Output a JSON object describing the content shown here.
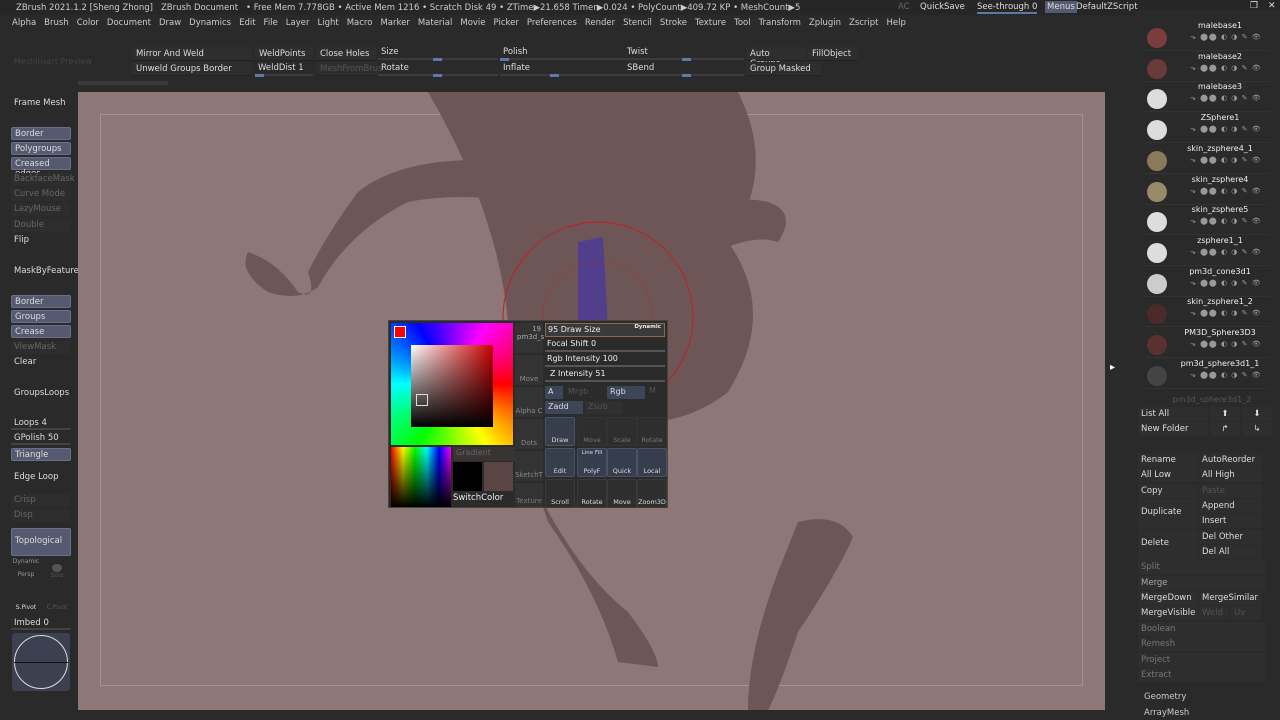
{
  "title": {
    "app": "ZBrush 2021.1.2 [Sheng Zhong]",
    "doc": "ZBrush Document",
    "stats": "• Free Mem 7.778GB • Active Mem 1216 • Scratch Disk 49 • ZTime▶21.658 Timer▶0.024 • PolyCount▶409.72 KP • MeshCount▶5",
    "ac": "AC",
    "quicksave": "QuickSave",
    "seethrough": "See-through  0",
    "menus": "Menus",
    "script": "DefaultZScript"
  },
  "menus": [
    "Alpha",
    "Brush",
    "Color",
    "Document",
    "Draw",
    "Dynamics",
    "Edit",
    "File",
    "Layer",
    "Light",
    "Macro",
    "Marker",
    "Material",
    "Movie",
    "Picker",
    "Preferences",
    "Render",
    "Stencil",
    "Stroke",
    "Texture",
    "Tool",
    "Transform",
    "Zplugin",
    "Zscript",
    "Help"
  ],
  "shelf": {
    "meshinsert": "MeshInsert Preview",
    "mirror_weld": "Mirror And Weld",
    "unweld": "Unweld Groups Border",
    "weldpoints": "WeldPoints",
    "welddist": "WeldDist 1",
    "close_holes": "Close Holes",
    "meshfrombrush": "MeshFromBrus",
    "size": "Size",
    "rotate": "Rotate",
    "polish": "Polish",
    "inflate": "Inflate",
    "twist": "Twist",
    "sbend": "SBend",
    "auto_groups": "Auto Groups",
    "fillobject": "FillObject",
    "group_masked": "Group Masked"
  },
  "left": {
    "frame_mesh": "Frame Mesh",
    "border": "Border",
    "polygroups": "Polygroups",
    "creased": "Creased edges",
    "backface": "BackfaceMask",
    "curve": "Curve Mode",
    "lazy": "LazyMouse",
    "double": "Double",
    "flip": "Flip",
    "maskbyfeature": "MaskByFeature",
    "border2": "Border",
    "groups": "Groups",
    "crease": "Crease",
    "viewmask": "ViewMask",
    "clear": "Clear",
    "groupsloops": "GroupsLoops",
    "loops": "Loops 4",
    "gpolish": "GPolish 50",
    "triangle": "Triangle",
    "edgeloop": "Edge Loop",
    "crisp": "Crisp",
    "disp": "Disp",
    "topological": "Topological",
    "persp": "Persp",
    "solo": "Solo",
    "dynamic": "Dynamic",
    "spivot": "S.Pivot",
    "cpivot": "C.Pivot",
    "imbed": "Imbed 0"
  },
  "popup": {
    "count": "19",
    "tool": "pm3d_s",
    "move": "Move",
    "alpha": "Alpha C",
    "dots": "Dots",
    "sketch": "SketchT",
    "texture": "Texture",
    "gradient": "Gradient",
    "switchcolor": "SwitchColor",
    "draw_size": "95 Draw Size",
    "dynamic": "Dynamic",
    "focal": "Focal Shift 0",
    "rgb_int": "Rgb Intensity 100",
    "z_int": "Z Intensity 51",
    "a": "A",
    "mrgb": "Mrgb",
    "rgb": "Rgb",
    "m": "M",
    "zadd": "Zadd",
    "zsub": "Zsub",
    "draw": "Draw",
    "pmove": "Move",
    "scale": "Scale",
    "protate": "Rotate",
    "edit": "Edit",
    "linefill": "Line Fill",
    "polyf": "PolyF",
    "quick": "Quick",
    "local": "Local",
    "scroll": "Scroll",
    "vrotate": "Rotate",
    "vmove": "Move",
    "zoom3d": "Zoom3D"
  },
  "subtools": [
    {
      "name": "malebase1",
      "c": "#7a3c3c"
    },
    {
      "name": "malebase2",
      "c": "#6a3a3a"
    },
    {
      "name": "malebase3",
      "c": "#ddd"
    },
    {
      "name": "ZSphere1",
      "c": "#ddd"
    },
    {
      "name": "skin_zsphere4_1",
      "c": "#8a7a5a"
    },
    {
      "name": "skin_zsphere4",
      "c": "#9a8a6a"
    },
    {
      "name": "skin_zsphere5",
      "c": "#ddd"
    },
    {
      "name": "zsphere1_1",
      "c": "#ddd"
    },
    {
      "name": "pm3d_cone3d1",
      "c": "#ccc"
    },
    {
      "name": "skin_zsphere1_2",
      "c": "#4a2a2a"
    },
    {
      "name": "PM3D_Sphere3D3",
      "c": "#5a3030"
    },
    {
      "name": "pm3d_sphere3d1_1",
      "c": "#444"
    }
  ],
  "subtool_last": "pm3d_sphere3d1_2",
  "right": {
    "list_all": "List All",
    "new_folder": "New Folder",
    "rename": "Rename",
    "autoreorder": "AutoReorder",
    "all_low": "All Low",
    "all_high": "All High",
    "copy": "Copy",
    "paste": "Paste",
    "duplicate": "Duplicate",
    "append": "Append",
    "insert": "Insert",
    "delete": "Delete",
    "del_other": "Del Other",
    "del_all": "Del All",
    "split": "Split",
    "merge": "Merge",
    "mergedown": "MergeDown",
    "mergesimilar": "MergeSimilar",
    "mergevisible": "MergeVisible",
    "weld": "Weld",
    "uv": "Uv",
    "boolean": "Boolean",
    "remesh": "Remesh",
    "project": "Project",
    "extract": "Extract",
    "geometry": "Geometry",
    "arraymesh": "ArrayMesh"
  },
  "colors": {
    "canvas": "#8d7777",
    "accent": "#555a70",
    "mesh": "#6f5656",
    "brush_circle": "#c02020"
  }
}
